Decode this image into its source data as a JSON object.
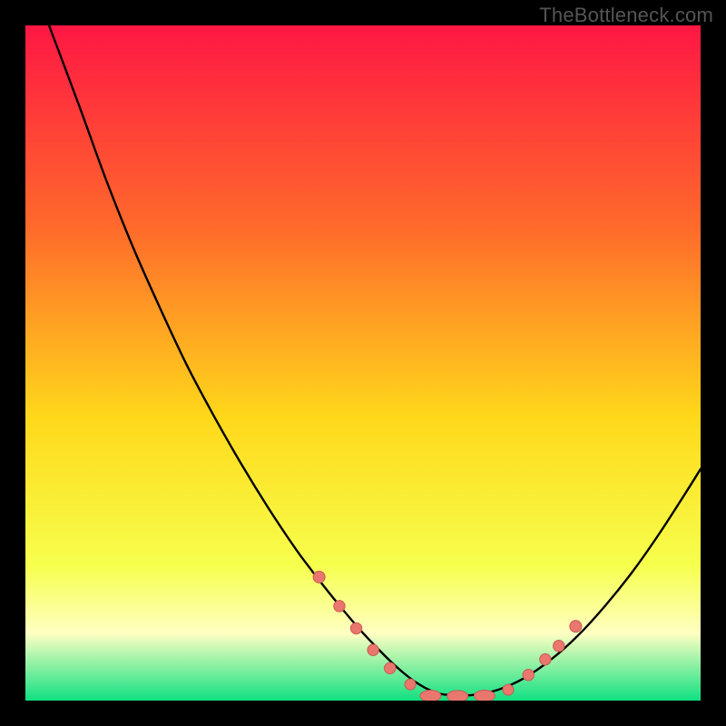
{
  "watermark": "TheBottleneck.com",
  "colors": {
    "frame": "#000000",
    "gradient_top": "#ff1744",
    "gradient_upper_mid": "#ff6a2b",
    "gradient_mid": "#ffd81a",
    "gradient_lower_mid": "#f6ff4d",
    "gradient_band_pale": "#ffffc2",
    "gradient_bottom": "#10e082",
    "curve": "#000000",
    "marker_fill": "#e9776e",
    "marker_stroke": "#c95a53"
  },
  "chart_data": {
    "type": "line",
    "title": "",
    "xlabel": "",
    "ylabel": "",
    "xlim": [
      0,
      100
    ],
    "ylim": [
      0,
      100
    ],
    "series": [
      {
        "name": "bottleneck-curve",
        "x": [
          3.5,
          8,
          12,
          16,
          20,
          24,
          28,
          32,
          36,
          40,
          42,
          44,
          46,
          48,
          50,
          52,
          54,
          56,
          58,
          60,
          62,
          66,
          70,
          74,
          78,
          82,
          86,
          90,
          94,
          98,
          100
        ],
        "y": [
          100,
          88,
          77,
          67,
          58,
          49.5,
          42,
          35,
          28.5,
          22.5,
          19.8,
          17.2,
          14.7,
          12.3,
          10,
          7.9,
          5.9,
          4.1,
          2.6,
          1.5,
          0.9,
          0.8,
          1.6,
          3.4,
          6.2,
          9.8,
          14.2,
          19.2,
          24.9,
          31.1,
          34.3
        ]
      }
    ],
    "markers": [
      {
        "x": 43.5,
        "y": 18.3,
        "r": 6.5
      },
      {
        "x": 46.5,
        "y": 14.0,
        "r": 6.2
      },
      {
        "x": 49.0,
        "y": 10.7,
        "r": 6.2
      },
      {
        "x": 51.5,
        "y": 7.5,
        "r": 6.2
      },
      {
        "x": 54.0,
        "y": 4.8,
        "r": 6.2
      },
      {
        "x": 57.0,
        "y": 2.4,
        "r": 6.0
      },
      {
        "x": 60.0,
        "y": 0.7,
        "r": 11.5,
        "flat": true
      },
      {
        "x": 64.0,
        "y": 0.65,
        "r": 11.5,
        "flat": true
      },
      {
        "x": 68.0,
        "y": 0.7,
        "r": 11.5,
        "flat": true
      },
      {
        "x": 71.5,
        "y": 1.6,
        "r": 6.0
      },
      {
        "x": 74.5,
        "y": 3.8,
        "r": 6.2
      },
      {
        "x": 77.0,
        "y": 6.1,
        "r": 6.2
      },
      {
        "x": 79.0,
        "y": 8.1,
        "r": 6.2
      },
      {
        "x": 81.5,
        "y": 11.0,
        "r": 6.5
      }
    ]
  }
}
